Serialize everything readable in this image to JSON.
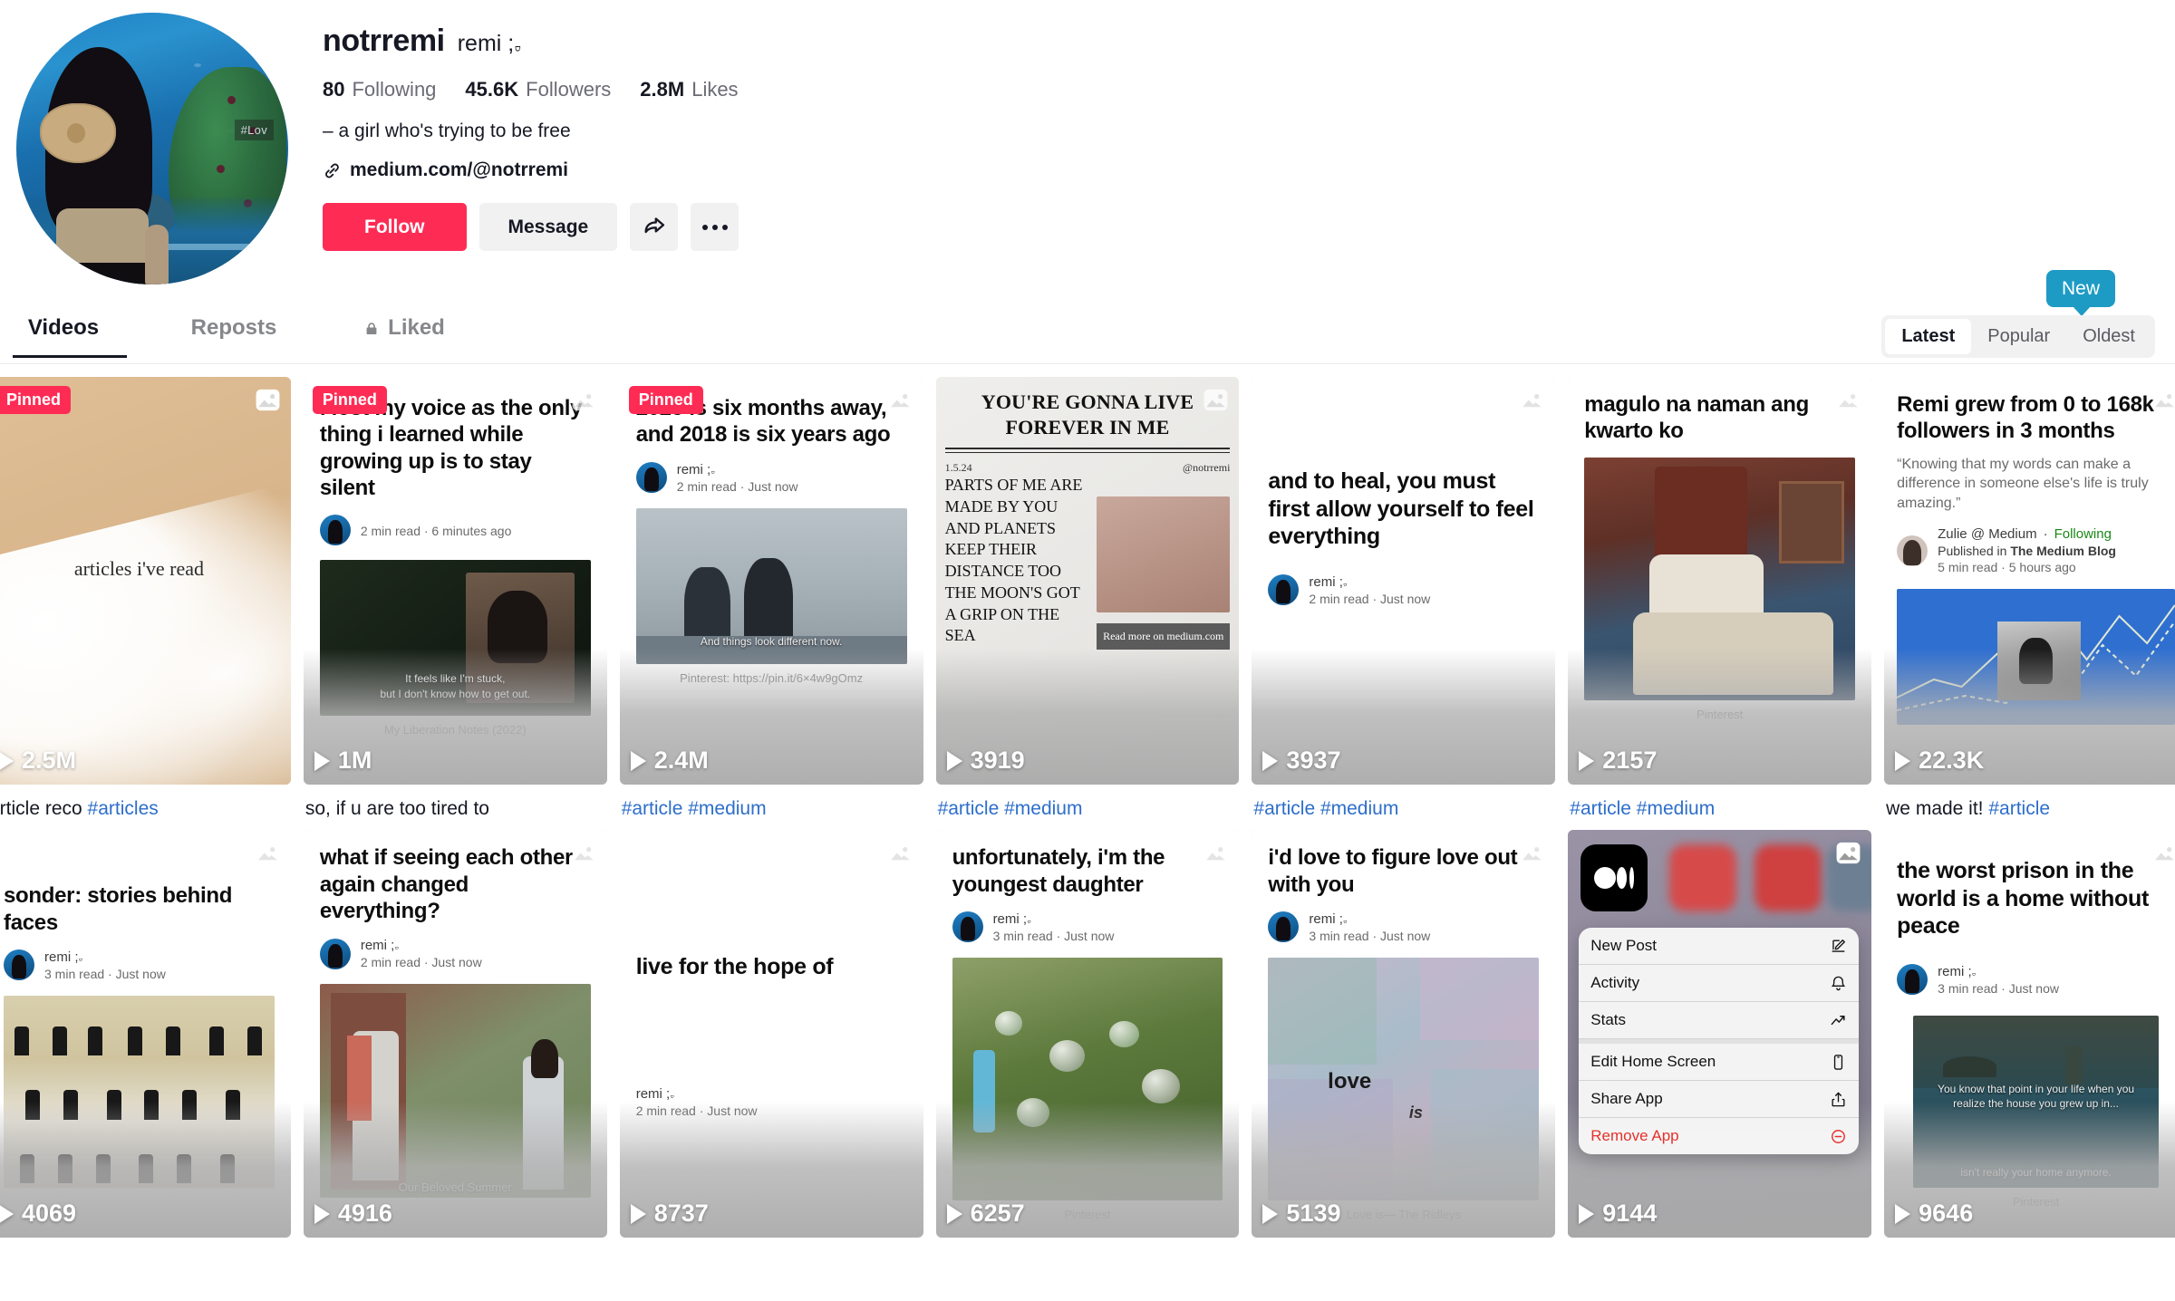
{
  "profile": {
    "username": "notrremi",
    "nickname": "remi ;⁠𝅒",
    "stats": [
      {
        "value": "80",
        "label": "Following"
      },
      {
        "value": "45.6K",
        "label": "Followers"
      },
      {
        "value": "2.8M",
        "label": "Likes"
      }
    ],
    "bio": "– a girl who's trying to be free",
    "link": "medium.com/@notrremi",
    "avatar_watermark": "#Lov",
    "buttons": {
      "follow": "Follow",
      "message": "Message",
      "share_icon": "share-arrow-icon",
      "more_icon": "more-dots-icon"
    },
    "accent_color": "#fe2c55"
  },
  "tabs": [
    {
      "id": "videos",
      "label": "Videos",
      "active": true,
      "locked": false
    },
    {
      "id": "reposts",
      "label": "Reposts",
      "active": false,
      "locked": false
    },
    {
      "id": "liked",
      "label": "Liked",
      "active": false,
      "locked": true
    }
  ],
  "sort": {
    "new_badge": "New",
    "badge_color": "#1d9bc4",
    "options": [
      {
        "label": "Latest",
        "active": true
      },
      {
        "label": "Popular",
        "active": false
      },
      {
        "label": "Oldest",
        "active": false
      }
    ]
  },
  "videos": [
    {
      "id": "v1",
      "style": "beach",
      "pinned": "Pinned",
      "views": "2.5M",
      "caption_text": "article reco ",
      "caption_tags": "#articles",
      "overlay_text": "articles i've read"
    },
    {
      "id": "v2",
      "style": "article",
      "pinned": "Pinned",
      "views": "1M",
      "caption_text": "so, if u are too tired to ",
      "caption_tags": "",
      "title": "i lost my voice as the only thing i learned while growing up is to stay silent",
      "author": "",
      "meta": "2 min read  ·  6 minutes ago",
      "image_caption": "My Liberation Notes (2022)",
      "subtitle_line1": "It feels like I'm stuck,",
      "subtitle_line2": "but I don't know how to get out."
    },
    {
      "id": "v3",
      "style": "article",
      "pinned": "Pinned",
      "views": "2.4M",
      "caption_text": "",
      "caption_tags": "#article #medium",
      "title": "2025 is six months away, and 2018 is six years ago",
      "author": "remi ;⁠𝅒",
      "meta": "2 min read  ·  Just now",
      "image_caption": "Pinterest: https://pin.it/6×4w9gOmz",
      "subtitle_line1": "And things look different now.",
      "subtitle_line2": ""
    },
    {
      "id": "v4",
      "style": "newspaper",
      "pinned": "",
      "views": "3919",
      "caption_text": "",
      "caption_tags": "#article #medium",
      "headline": "YOU'RE GONNA LIVE FOREVER IN ME",
      "np_date": "1.5.24",
      "np_handle": "@notrremi",
      "np_body": "PARTS OF ME ARE MADE BY YOU AND PLANETS KEEP THEIR DISTANCE TOO THE MOON'S GOT A GRIP ON THE SEA",
      "np_readmore": "Read more on medium.com"
    },
    {
      "id": "v5",
      "style": "article",
      "pinned": "",
      "views": "3937",
      "caption_text": "",
      "caption_tags": "#article #medium",
      "title": "and to heal, you must first allow yourself to feel everything",
      "author": "remi ;⁠𝅒",
      "meta": "2 min read  ·  Just now",
      "image_caption": "",
      "subtitle_line1": "",
      "subtitle_line2": ""
    },
    {
      "id": "v6",
      "style": "article",
      "pinned": "",
      "views": "2157",
      "caption_text": "",
      "caption_tags": "#article #medium",
      "title": "magulo na naman ang kwarto ko",
      "author": "",
      "meta": "",
      "image_caption": "Pinterest",
      "subtitle_line1": "",
      "subtitle_line2": ""
    },
    {
      "id": "v7",
      "style": "medium-blog",
      "pinned": "",
      "views": "22.3K",
      "caption_text": "we made it! ",
      "caption_tags": "#article",
      "title": "Remi grew from 0 to 168k followers in 3 months",
      "quote": "“Knowing that my words can make a difference in someone else's life is truly amazing.”",
      "author": "Zulie @ Medium",
      "following": "Following",
      "published_in": "Published in ",
      "publication": "The Medium Blog",
      "meta": "5  min read  ·  5 hours ago"
    },
    {
      "id": "v8",
      "style": "article",
      "pinned": "",
      "views": "4069",
      "caption_text": "",
      "caption_tags": "",
      "title": "sonder: stories behind faces",
      "author": "remi ;⁠𝅒",
      "meta": "3 min read  ·  Just now",
      "image_caption": "",
      "subtitle_line1": "",
      "subtitle_line2": ""
    },
    {
      "id": "v9",
      "style": "article",
      "pinned": "",
      "views": "4916",
      "caption_text": "",
      "caption_tags": "",
      "title": "what if seeing each other again changed everything?",
      "author": "remi ;⁠𝅒",
      "meta": "2 min read  ·  Just now",
      "image_caption": "Our Beloved Summer",
      "subtitle_line1": "",
      "subtitle_line2": ""
    },
    {
      "id": "v10",
      "style": "article",
      "pinned": "",
      "views": "8737",
      "caption_text": "",
      "caption_tags": "",
      "title": "live for the hope of",
      "author": "remi ;⁠𝅒",
      "meta": "2 min read  ·  Just now",
      "image_caption": "",
      "subtitle_line1": "",
      "subtitle_line2": ""
    },
    {
      "id": "v11",
      "style": "article",
      "pinned": "",
      "views": "6257",
      "caption_text": "",
      "caption_tags": "",
      "title": "unfortunately, i'm the youngest daughter",
      "author": "remi ;⁠𝅒",
      "meta": "3 min read  ·  Just now",
      "image_caption": "Pinterest",
      "subtitle_line1": "",
      "subtitle_line2": ""
    },
    {
      "id": "v12",
      "style": "article",
      "pinned": "",
      "views": "5139",
      "caption_text": "",
      "caption_tags": "",
      "title": "i'd love to figure love out with you",
      "author": "remi ;⁠𝅒",
      "meta": "3 min read  ·  Just now",
      "image_caption": "Love is— The Ridleys",
      "subtitle_line1": "",
      "subtitle_line2": ""
    },
    {
      "id": "v13",
      "style": "ios-menu",
      "pinned": "",
      "views": "9144",
      "caption_text": "",
      "caption_tags": "",
      "menu_items": [
        {
          "label": "New Post",
          "icon": "compose-icon",
          "danger": false
        },
        {
          "label": "Activity",
          "icon": "bell-icon",
          "danger": false
        },
        {
          "label": "Stats",
          "icon": "trend-up-icon",
          "danger": false
        },
        {
          "label": "Edit Home Screen",
          "icon": "phone-icon",
          "danger": false
        },
        {
          "label": "Share App",
          "icon": "share-up-icon",
          "danger": false
        },
        {
          "label": "Remove App",
          "icon": "minus-circle-icon",
          "danger": true
        }
      ]
    },
    {
      "id": "v14",
      "style": "article",
      "pinned": "",
      "views": "9646",
      "caption_text": "",
      "caption_tags": "",
      "title": "the worst prison in the world is a home without peace",
      "author": "remi ;⁠𝅒",
      "meta": "3  min read  ·  Just now",
      "image_caption": "Pinterest",
      "subtitle_line1": "You know that point in your life when you realize the house you grew up in...",
      "subtitle_line2": "isn't really your home anymore."
    }
  ]
}
